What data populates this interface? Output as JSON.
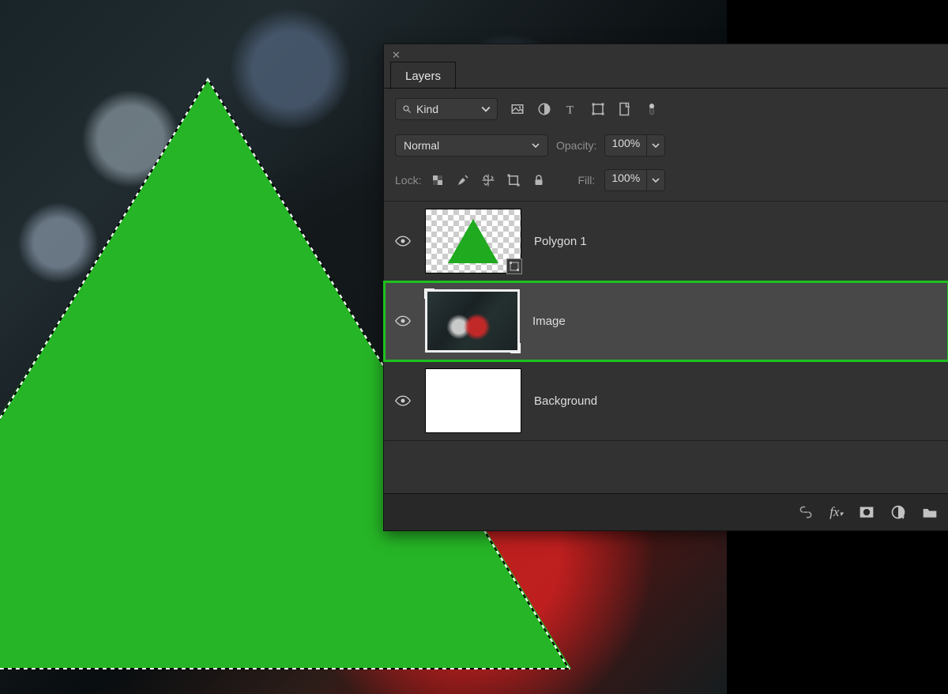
{
  "panel": {
    "tab": "Layers"
  },
  "filter": {
    "kind": "Kind"
  },
  "blend": {
    "mode": "Normal",
    "opacity_label": "Opacity:",
    "opacity_value": "100%"
  },
  "lock": {
    "label": "Lock:",
    "fill_label": "Fill:",
    "fill_value": "100%"
  },
  "layers": [
    {
      "name": "Polygon 1"
    },
    {
      "name": "Image"
    },
    {
      "name": "Background"
    }
  ]
}
